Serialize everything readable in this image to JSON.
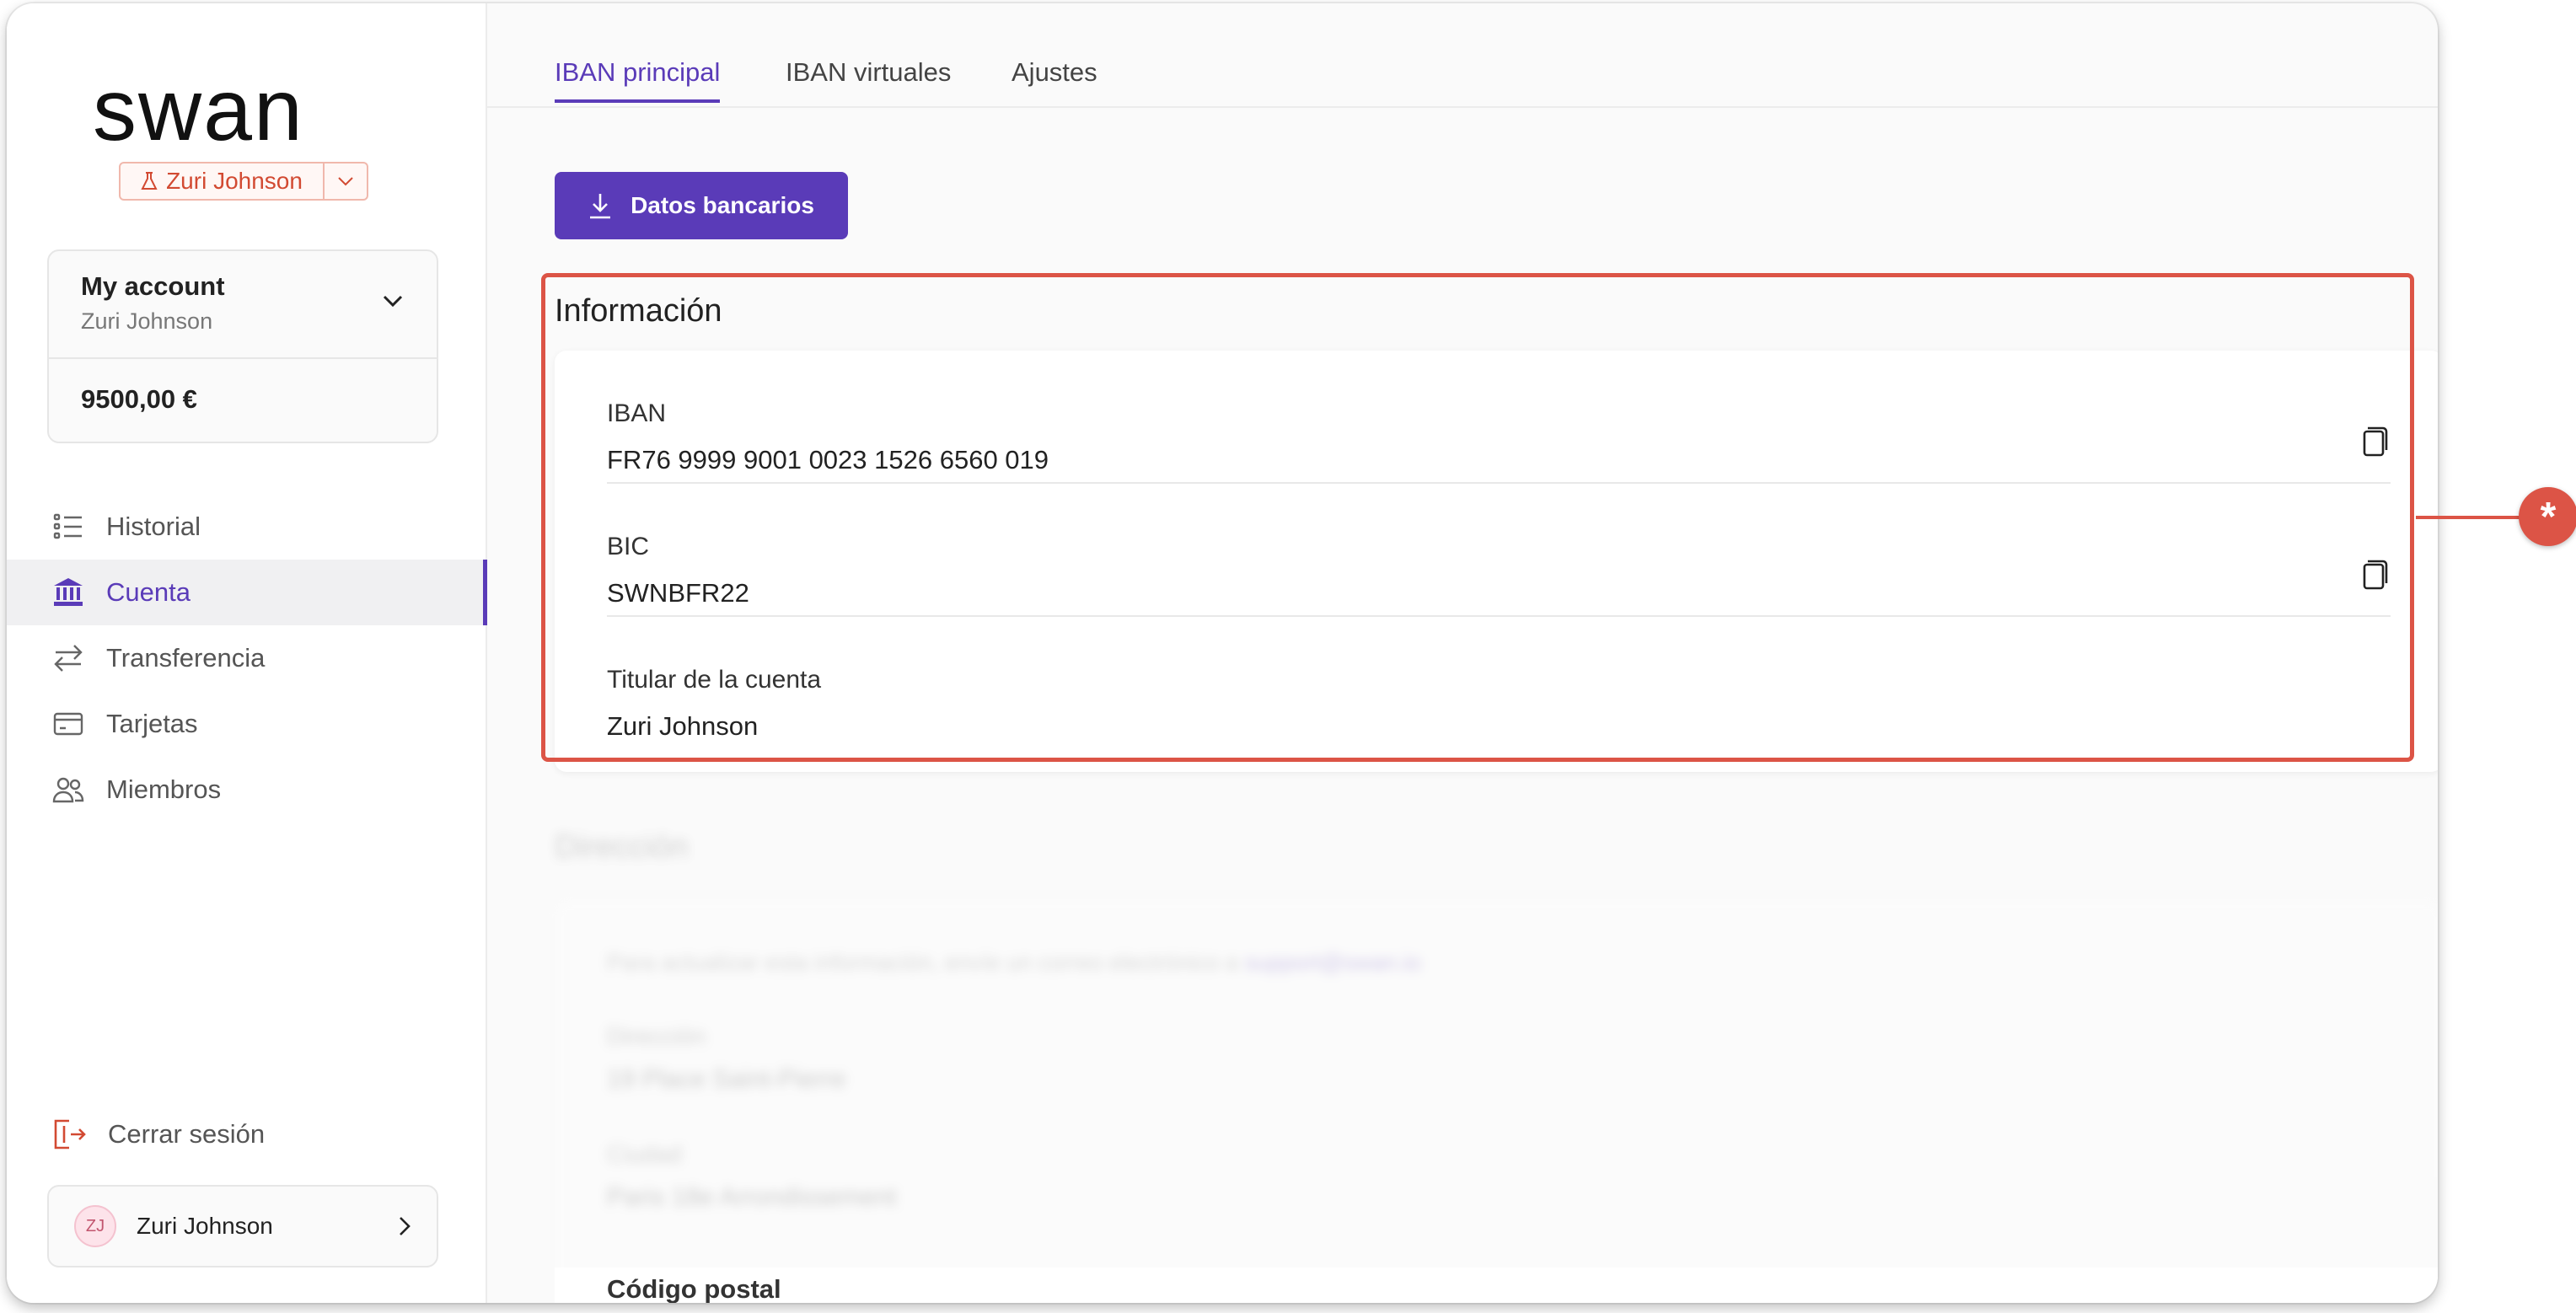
{
  "brand": {
    "logo_text": "swan",
    "accent": "#5a3bb8",
    "highlight": "#dc5446"
  },
  "env_badge": {
    "user": "Zuri Johnson",
    "icon": "flask-icon"
  },
  "account": {
    "title": "My account",
    "holder": "Zuri Johnson",
    "balance": "9500,00 €"
  },
  "nav": {
    "items": [
      {
        "label": "Historial",
        "icon": "list-icon",
        "active": false
      },
      {
        "label": "Cuenta",
        "icon": "bank-icon",
        "active": true
      },
      {
        "label": "Transferencia",
        "icon": "transfer-icon",
        "active": false
      },
      {
        "label": "Tarjetas",
        "icon": "card-icon",
        "active": false
      },
      {
        "label": "Miembros",
        "icon": "members-icon",
        "active": false
      }
    ]
  },
  "logout": {
    "label": "Cerrar sesión"
  },
  "user": {
    "initials": "ZJ",
    "name": "Zuri Johnson"
  },
  "tabs": [
    {
      "label": "IBAN principal",
      "active": true
    },
    {
      "label": "IBAN virtuales",
      "active": false
    },
    {
      "label": "Ajustes",
      "active": false
    }
  ],
  "download_button": {
    "label": "Datos bancarios"
  },
  "info": {
    "title": "Información",
    "rows": [
      {
        "label": "IBAN",
        "value": "FR76 9999 9001 0023 1526 6560 019"
      },
      {
        "label": "BIC",
        "value": "SWNBFR22"
      },
      {
        "label": "Titular de la cuenta",
        "value": "Zuri Johnson"
      }
    ]
  },
  "address": {
    "title": "Dirección",
    "note": "Para actualizar esta información, envíe un correo electrónico a",
    "email": "support@swan.io",
    "street_label": "Dirección",
    "street_value": "19 Place Saint-Pierre",
    "city_label": "Ciudad",
    "city_value": "Paris 18e Arrondissement",
    "postal_label": "Código postal"
  },
  "callout": {
    "symbol": "*"
  }
}
